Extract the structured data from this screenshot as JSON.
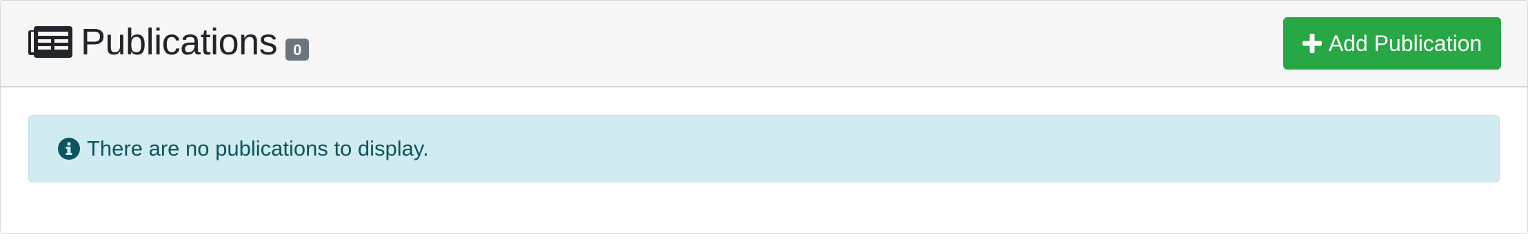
{
  "header": {
    "title": "Publications",
    "count": "0",
    "icon": "newspaper-icon",
    "add_button_label": "Add Publication",
    "add_button_icon": "plus-icon"
  },
  "alert": {
    "icon": "info-circle-icon",
    "message": "There are no publications to display."
  },
  "colors": {
    "header_bg": "#f7f7f7",
    "title_text": "#212529",
    "badge_bg": "#6c757d",
    "add_button_bg": "#28a745",
    "alert_bg": "#d1ecf1",
    "alert_border": "#bee5eb",
    "alert_text": "#0c5460"
  }
}
